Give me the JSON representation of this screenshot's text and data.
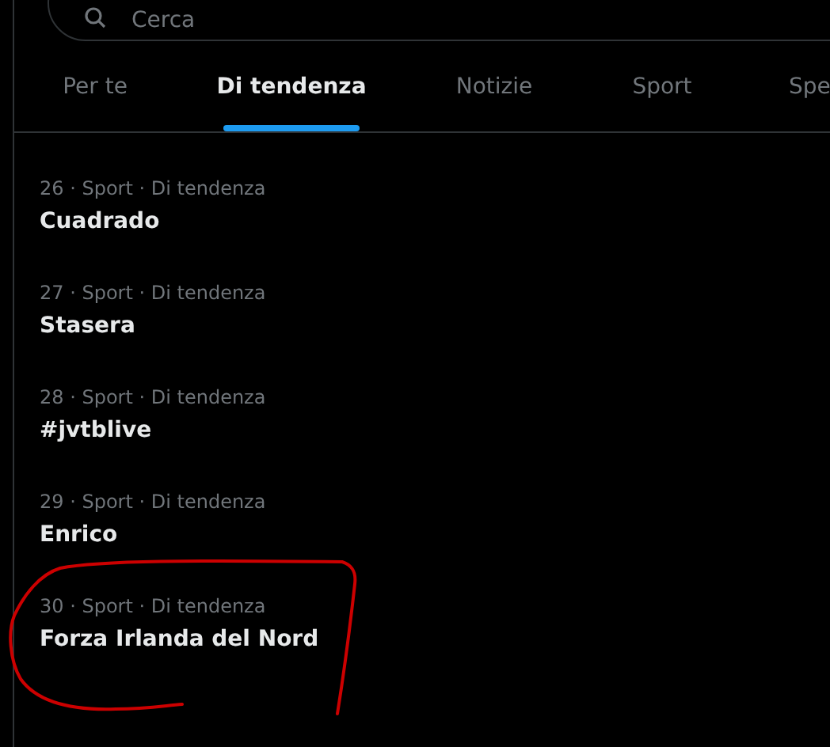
{
  "search": {
    "placeholder": "Cerca"
  },
  "tabs": [
    {
      "label": "Per te",
      "selected": false
    },
    {
      "label": "Di tendenza",
      "selected": true
    },
    {
      "label": "Notizie",
      "selected": false
    },
    {
      "label": "Sport",
      "selected": false
    },
    {
      "label": "Spe",
      "selected": false
    }
  ],
  "trends": [
    {
      "meta": "26 · Sport · Di tendenza",
      "title": "Cuadrado"
    },
    {
      "meta": "27 · Sport · Di tendenza",
      "title": "Stasera"
    },
    {
      "meta": "28 · Sport · Di tendenza",
      "title": "#jvtblive"
    },
    {
      "meta": "29 · Sport · Di tendenza",
      "title": "Enrico"
    },
    {
      "meta": "30 · Sport · Di tendenza",
      "title": "Forza Irlanda del Nord"
    }
  ]
}
